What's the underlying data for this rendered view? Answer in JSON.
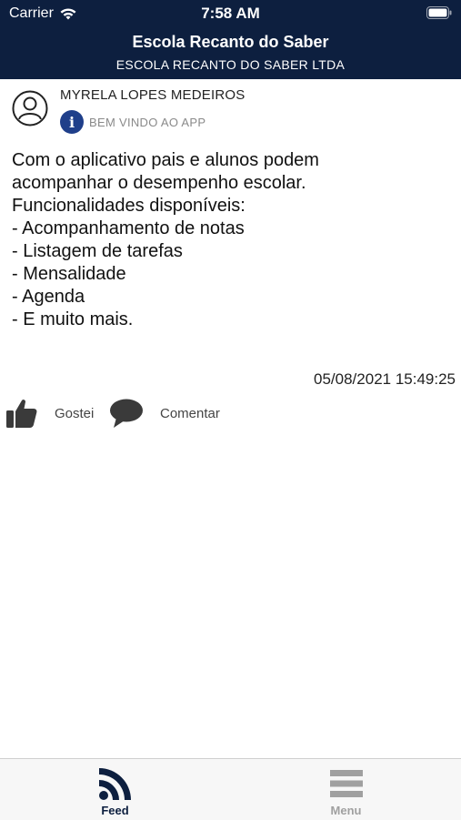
{
  "status_bar": {
    "carrier": "Carrier",
    "time": "7:58 AM",
    "icons": [
      "wifi-icon",
      "battery-icon"
    ]
  },
  "header": {
    "title": "Escola Recanto do Saber",
    "subtitle": "ESCOLA RECANTO DO SABER LTDA",
    "background_color": "#0d1f3f"
  },
  "post": {
    "author": "MYRELA LOPES MEDEIROS",
    "tag": "BEM VINDO AO APP",
    "tag_icon": "info-icon",
    "body_lines": [
      "Com o aplicativo pais e alunos podem",
      "acompanhar o desempenho escolar.",
      "Funcionalidades disponíveis:",
      "- Acompanhamento de notas",
      "- Listagem de tarefas",
      "- Mensalidade",
      "- Agenda",
      "- E muito mais."
    ],
    "timestamp": "05/08/2021 15:49:25",
    "actions": {
      "like_label": "Gostei",
      "comment_label": "Comentar"
    }
  },
  "tabbar": {
    "tabs": [
      {
        "label": "Feed",
        "icon": "rss-feed-icon",
        "active": true
      },
      {
        "label": "Menu",
        "icon": "menu-icon",
        "active": false
      }
    ],
    "active_color": "#0d1f3f",
    "inactive_color": "#a0a0a0"
  }
}
